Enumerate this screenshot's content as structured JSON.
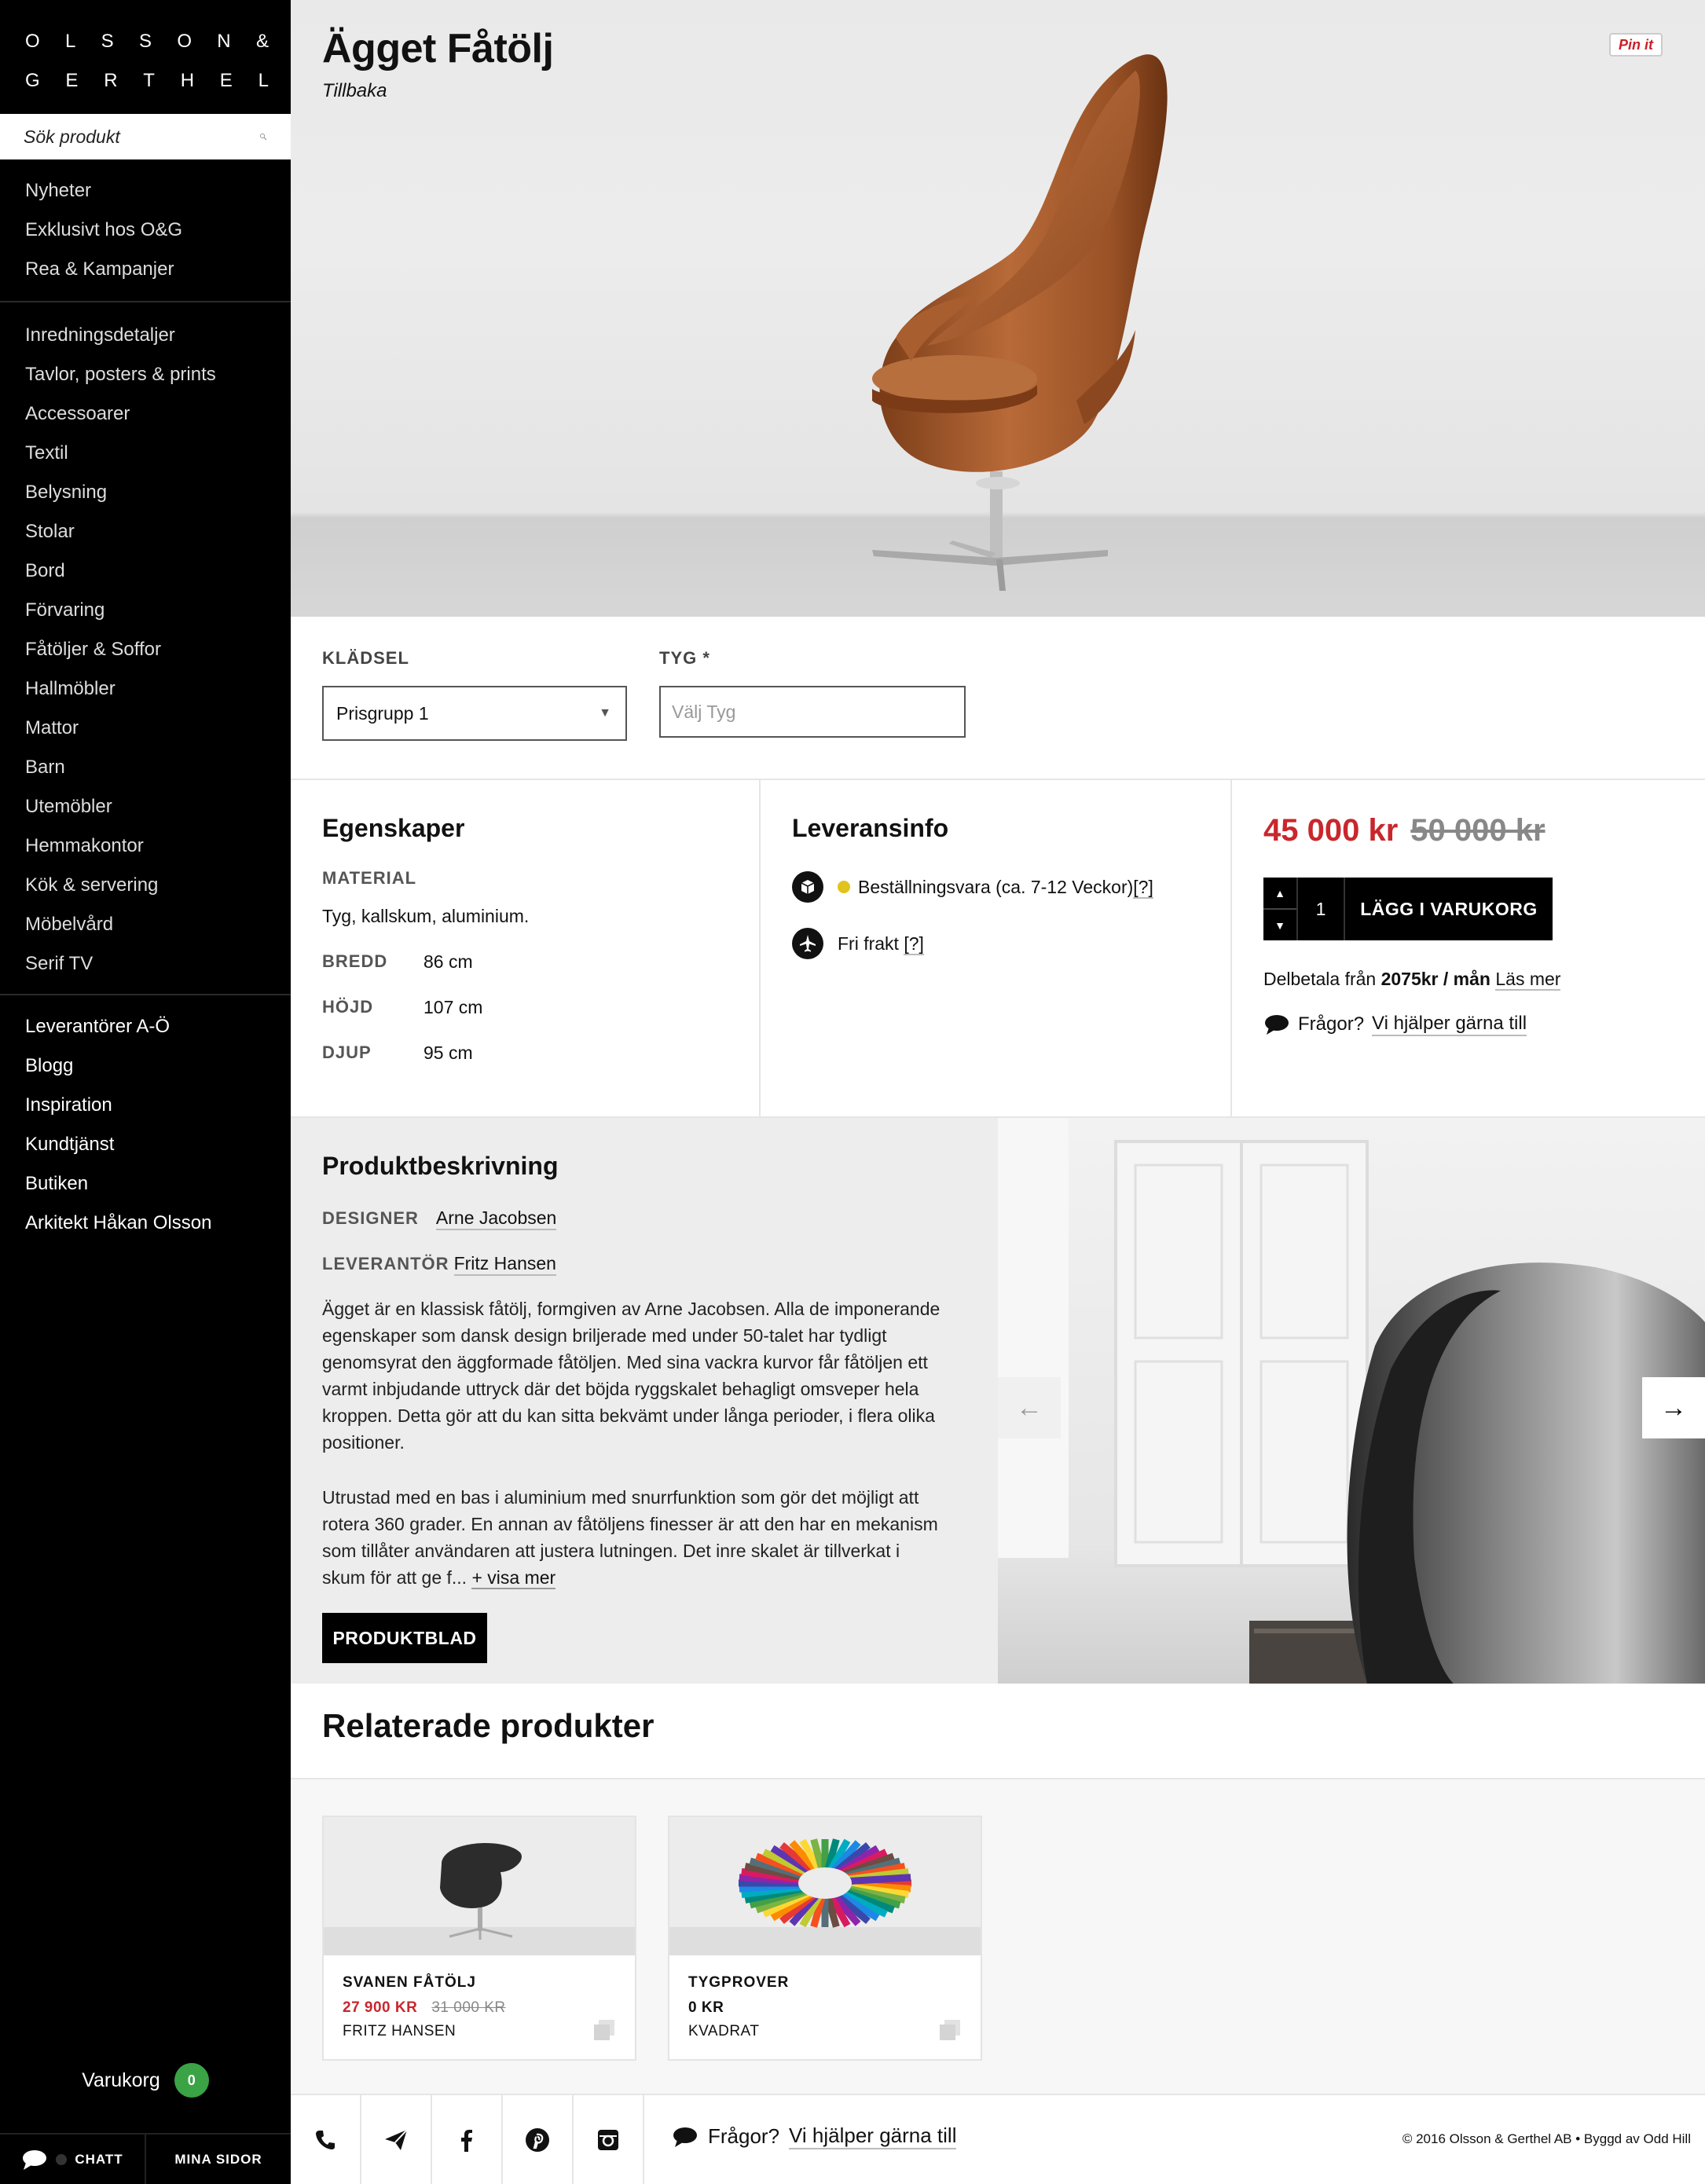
{
  "brand": {
    "logo_line1": [
      "O",
      "L",
      "S",
      "S",
      "O",
      "N",
      "&"
    ],
    "logo_line2": [
      "G",
      "E",
      "R",
      "T",
      "H",
      "E",
      "L"
    ]
  },
  "search": {
    "placeholder": "Sök produkt"
  },
  "nav": {
    "group1": [
      "Nyheter",
      "Exklusivt hos O&G",
      "Rea & Kampanjer"
    ],
    "group2": [
      "Inredningsdetaljer",
      "Tavlor, posters & prints",
      "Accessoarer",
      "Textil",
      "Belysning",
      "Stolar",
      "Bord",
      "Förvaring",
      "Fåtöljer & Soffor",
      "Hallmöbler",
      "Mattor",
      "Barn",
      "Utemöbler",
      "Hemmakontor",
      "Kök & servering",
      "Möbelvård",
      "Serif TV"
    ],
    "group3": [
      "Leverantörer A-Ö",
      "Blogg",
      "Inspiration",
      "Kundtjänst",
      "Butiken",
      "Arkitekt Håkan Olsson"
    ]
  },
  "cart": {
    "label": "Varukorg",
    "count": "0"
  },
  "sidebar_bottom": {
    "chat": "CHATT",
    "my_pages": "MINA SIDOR"
  },
  "product": {
    "title": "Ägget Fåtölj",
    "back": "Tillbaka",
    "pin": "Pin it"
  },
  "options": {
    "upholstery_label": "KLÄDSEL",
    "upholstery_value": "Prisgrupp 1",
    "fabric_label": "TYG *",
    "fabric_placeholder": "Välj Tyg"
  },
  "properties": {
    "heading": "Egenskaper",
    "material_label": "MATERIAL",
    "material_value": "Tyg, kallskum, aluminium.",
    "width_label": "BREDD",
    "width_value": "86 cm",
    "height_label": "HÖJD",
    "height_value": "107 cm",
    "depth_label": "DJUP",
    "depth_value": "95 cm"
  },
  "delivery": {
    "heading": "Leveransinfo",
    "order_item": "Beställningsvara (ca. 7-12 Veckor)",
    "order_help": "[?]",
    "shipping": "Fri frakt",
    "shipping_help": "[?]"
  },
  "purchase": {
    "price": "45 000 kr",
    "old_price": "50 000 kr",
    "quantity": "1",
    "qty_up": "▲",
    "qty_down": "▼",
    "add_to_cart": "LÄGG I VARUKORG",
    "finance_prefix": "Delbetala från",
    "finance_amount": "2075kr / mån",
    "finance_link": "Läs mer",
    "questions": "Frågor?",
    "help_link": "Vi hjälper gärna till"
  },
  "description": {
    "heading": "Produktbeskrivning",
    "designer_label": "DESIGNER",
    "designer": "Arne Jacobsen",
    "supplier_label": "LEVERANTÖR",
    "supplier": "Fritz Hansen",
    "paragraph1": "Ägget är en klassisk fåtölj, formgiven av Arne Jacobsen. Alla de imponerande egenskaper som dansk design briljerade med under 50-talet har tydligt genomsyrat den äggformade fåtöljen. Med sina vackra kurvor får fåtöljen ett varmt inbjudande uttryck där det böjda ryggskalet behagligt omsveper hela kroppen. Detta gör att du kan sitta bekvämt under långa perioder, i flera olika positioner.",
    "paragraph2": "Utrustad med en bas i aluminium med snurrfunktion som gör det möjligt att rotera 360 grader. En annan av fåtöljens finesser är att den har en mekanism som tillåter användaren att justera lutningen. Det inre skalet är tillverkat i skum för att ge f...",
    "show_more": "+ visa mer",
    "datasheet": "PRODUKTBLAD"
  },
  "gallery": {
    "prev": "←",
    "next": "→"
  },
  "related": {
    "heading": "Relaterade produkter",
    "items": [
      {
        "name": "SVANEN FÅTÖLJ",
        "price": "27 900 KR",
        "old_price": "31 000 KR",
        "brand": "FRITZ HANSEN"
      },
      {
        "name": "TYGPROVER",
        "price": "0 KR",
        "old_price": "",
        "brand": "KVADRAT"
      }
    ]
  },
  "footer": {
    "questions": "Frågor?",
    "help_link": "Vi hjälper gärna till",
    "copyright": "© 2016 Olsson & Gerthel AB • Byggd av Odd Hill"
  },
  "colors": {
    "sale_red": "#c8272d",
    "badge_green": "#3aa345",
    "stock_yellow": "#e1c31b"
  }
}
